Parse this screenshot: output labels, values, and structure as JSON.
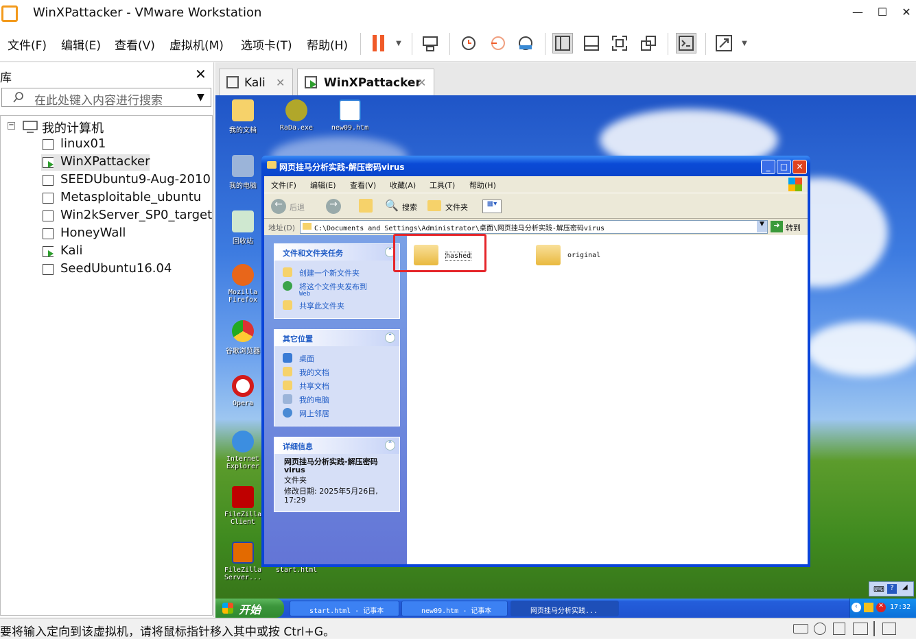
{
  "window": {
    "title": "WinXPattacker - VMware Workstation"
  },
  "menu": [
    "文件(F)",
    "编辑(E)",
    "查看(V)",
    "虚拟机(M)",
    "选项卡(T)",
    "帮助(H)"
  ],
  "library": {
    "title": "库",
    "search_placeholder": "在此处键入内容进行搜索",
    "root": "我的计算机",
    "vms": [
      "linux01",
      "WinXPattacker",
      "SEEDUbuntu9-Aug-2010",
      "Metasploitable_ubuntu",
      "Win2kServer_SP0_target",
      "HoneyWall",
      "Kali",
      "SeedUbuntu16.04"
    ],
    "selected": "WinXPattacker"
  },
  "tabs": [
    {
      "label": "Kali"
    },
    {
      "label": "WinXPattacker",
      "active": true
    }
  ],
  "desktop_icons": [
    "我的文档",
    "RaDa.exe",
    "new09.htm",
    "我的电脑",
    "回收站",
    "Mozilla Firefox",
    "谷歌浏览器",
    "Opera",
    "Internet Explorer",
    "FileZilla Client",
    "FileZilla Server...",
    "start.html"
  ],
  "explorer": {
    "title": "网页挂马分析实践-解压密码virus",
    "menu": [
      "文件(F)",
      "编辑(E)",
      "查看(V)",
      "收藏(A)",
      "工具(T)",
      "帮助(H)"
    ],
    "toolbar": {
      "back": "后退",
      "search": "搜索",
      "folders": "文件夹"
    },
    "address_label": "地址(D)",
    "address": "C:\\Documents and Settings\\Administrator\\桌面\\网页挂马分析实践-解压密码virus",
    "go": "转到",
    "tasks": {
      "header": "文件和文件夹任务",
      "items": [
        "创建一个新文件夹",
        "将这个文件夹发布到",
        "Web",
        "共享此文件夹"
      ]
    },
    "places": {
      "header": "其它位置",
      "items": [
        "桌面",
        "我的文档",
        "共享文档",
        "我的电脑",
        "网上邻居"
      ]
    },
    "details": {
      "header": "详细信息",
      "name": "网页挂马分析实践-解压密码virus",
      "type": "文件夹",
      "modified": "修改日期: 2025年5月26日, 17:29"
    },
    "folders": [
      "hashed",
      "original"
    ]
  },
  "taskbar": {
    "start": "开始",
    "tasks": [
      "start.html - 记事本",
      "new09.htm - 记事本",
      "网页挂马分析实践..."
    ],
    "clock": "17:32"
  },
  "status": "要将输入定向到该虚拟机，请将鼠标指针移入其中或按 Ctrl+G。",
  "colors": {
    "highlight": "#e5252a",
    "xp_blue": "#0a46cc",
    "pause": "#f05a28"
  }
}
